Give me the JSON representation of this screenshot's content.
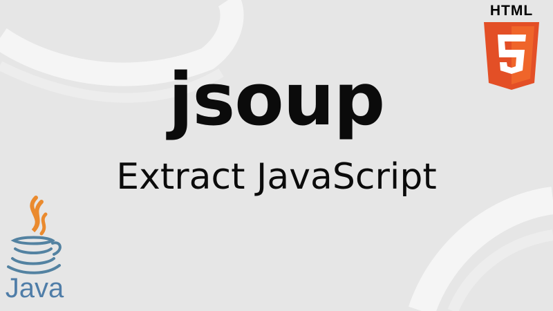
{
  "thumbnail": {
    "title": "jsoup",
    "subtitle": "Extract JavaScript"
  },
  "logos": {
    "html5": {
      "wordmark": "HTML",
      "icon": "html5-shield-icon",
      "shield_color": "#e34f26",
      "shield_light": "#ef652a"
    },
    "java": {
      "wordmark": "Java",
      "icon": "java-coffee-cup-icon",
      "steam_color": "#ea8a2e",
      "cup_color": "#5382a1"
    }
  },
  "colors": {
    "background": "#e6e6e6",
    "text": "#0b0b0b"
  }
}
